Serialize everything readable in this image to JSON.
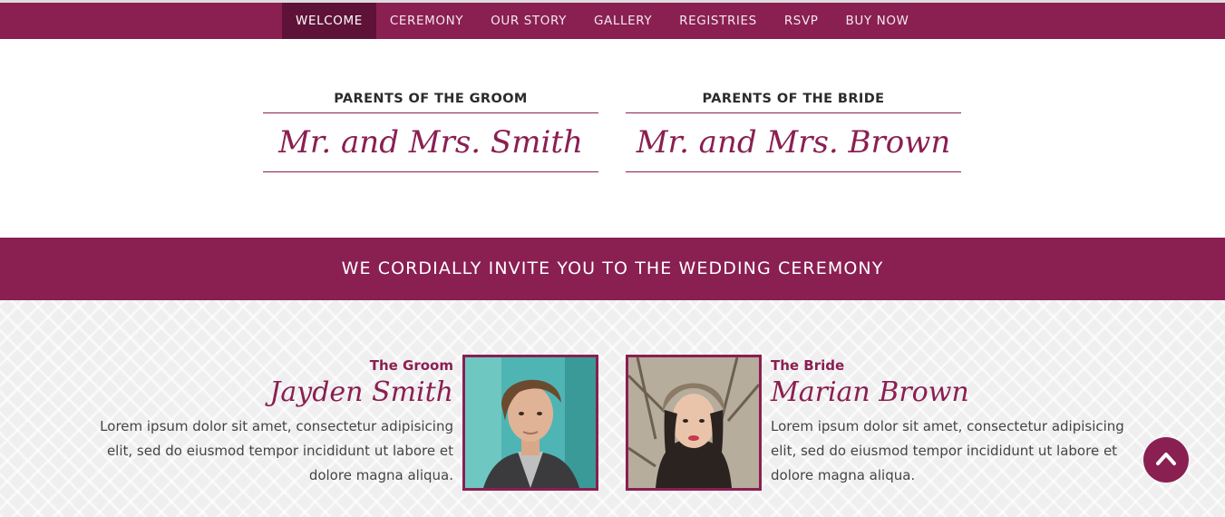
{
  "nav": {
    "items": [
      "WELCOME",
      "CEREMONY",
      "OUR STORY",
      "GALLERY",
      "REGISTRIES",
      "RSVP",
      "BUY NOW"
    ],
    "active": "WELCOME"
  },
  "parents": {
    "groom": {
      "title": "PARENTS OF THE GROOM",
      "names": "Mr. and Mrs. Smith"
    },
    "bride": {
      "title": "PARENTS OF THE BRIDE",
      "names": "Mr. and Mrs. Brown"
    }
  },
  "invite": {
    "heading": "WE CORDIALLY INVITE YOU TO THE WEDDING CEREMONY"
  },
  "couple": {
    "groom": {
      "role": "The Groom",
      "name": "Jayden Smith",
      "bio": "Lorem ipsum dolor sit amet, consectetur adipisicing elit, sed do eiusmod tempor incididunt ut labore et dolore magna aliqua."
    },
    "bride": {
      "role": "The Bride",
      "name": "Marian Brown",
      "bio": "Lorem ipsum dolor sit amet, consectetur adipisicing elit, sed do eiusmod tempor incididunt ut labore et dolore magna aliqua."
    }
  },
  "icons": {
    "scroll_top": "chevron-up-icon"
  },
  "colors": {
    "accent": "#8a1f52",
    "accent_dark": "#5e1238",
    "text": "#444444",
    "pattern_bg": "#efefef"
  }
}
